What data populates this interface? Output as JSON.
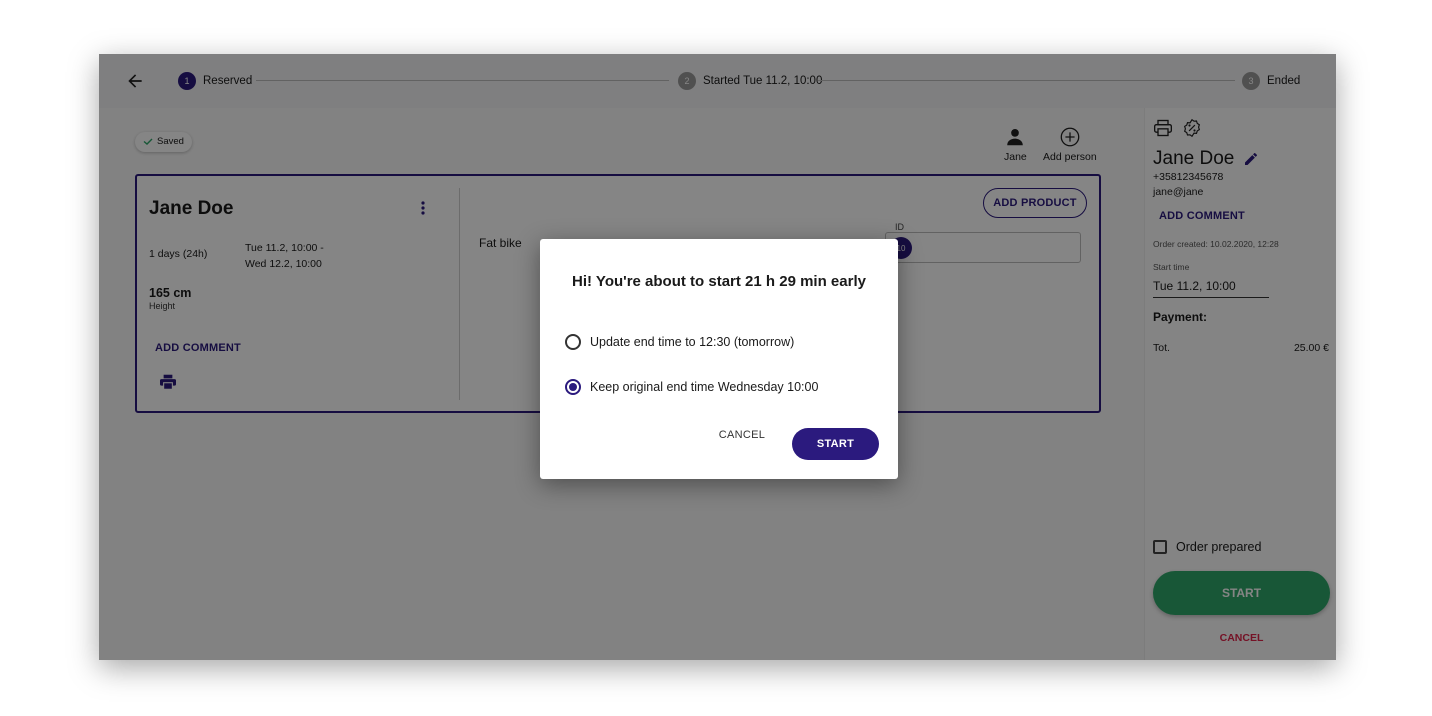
{
  "stepper": {
    "steps": [
      {
        "number": "1",
        "label": "Reserved",
        "state": "active"
      },
      {
        "number": "2",
        "label": "Started Tue 11.2, 10:00",
        "state": "inactive"
      },
      {
        "number": "3",
        "label": "Ended",
        "state": "inactive"
      }
    ]
  },
  "main": {
    "saved_label": "Saved",
    "persons": [
      {
        "label": "Jane",
        "icon": "person-icon"
      },
      {
        "label": "Add person",
        "icon": "add-circle-icon"
      }
    ]
  },
  "order_card": {
    "customer_name": "Jane Doe",
    "duration": "1 days (24h)",
    "date_from": "Tue 11.2, 10:00 -",
    "date_to": "Wed 12.2, 10:00",
    "height_value": "165 cm",
    "height_label": "Height",
    "add_comment": "ADD COMMENT",
    "add_product": "ADD PRODUCT",
    "product_name": "Fat bike",
    "id_label": "ID",
    "id_value": "10"
  },
  "sidebar": {
    "name": "Jane Doe",
    "phone": "+35812345678",
    "email": "jane@jane",
    "add_comment": "ADD COMMENT",
    "order_created": "Order created: 10.02.2020, 12:28",
    "start_time_label": "Start time",
    "start_time_value": "Tue 11.2, 10:00",
    "payment_label": "Payment:",
    "total_label": "Tot.",
    "total_value": "25.00 €",
    "order_prepared_label": "Order prepared",
    "start_button": "START",
    "cancel_link": "CANCEL"
  },
  "dialog": {
    "title": "Hi! You're about to start 21 h 29 min early",
    "options": [
      {
        "label": "Update end time to 12:30 (tomorrow)",
        "selected": false
      },
      {
        "label": "Keep original end time Wednesday 10:00",
        "selected": true
      }
    ],
    "cancel_label": "CANCEL",
    "start_label": "START"
  },
  "colors": {
    "accent": "#2b1a7e",
    "start_green": "#2ea86a",
    "cancel_red": "#e0244a"
  }
}
